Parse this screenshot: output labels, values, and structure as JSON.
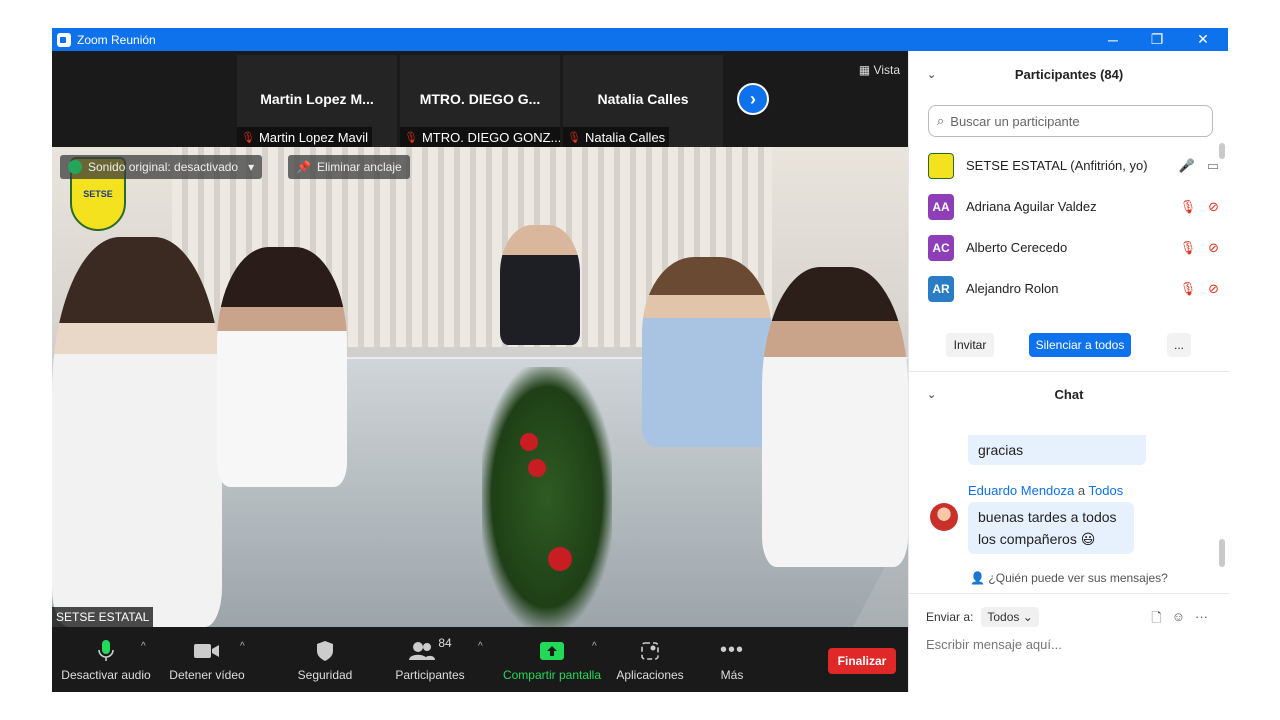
{
  "window": {
    "title": "Zoom Reunión",
    "controls": [
      "─",
      "❐",
      "✕"
    ]
  },
  "strip": {
    "tiles": [
      {
        "name": "Martin Lopez M...",
        "label": "Martin Lopez Mavil"
      },
      {
        "name": "MTRO. DIEGO G...",
        "label": "MTRO. DIEGO GONZ..."
      },
      {
        "name": "Natalia Calles",
        "label": "Natalia Calles"
      }
    ],
    "view_label": "Vista"
  },
  "video": {
    "sound_label": "Sonido original: desactivado",
    "unpin_label": "Eliminar anclaje",
    "speaker": "SETSE ESTATAL",
    "logo_text": "SETSE"
  },
  "toolbar": {
    "audio": "Desactivar audio",
    "video": "Detener vídeo",
    "security": "Seguridad",
    "participants": "Participantes",
    "participants_count": "84",
    "share": "Compartir pantalla",
    "apps": "Aplicaciones",
    "more": "Más",
    "end": "Finalizar"
  },
  "panel": {
    "participants_header": "Participantes (84)",
    "search_placeholder": "Buscar un participante",
    "participants": [
      {
        "initials": "",
        "name": "SETSE ESTATAL (Anfitrión, yo)",
        "color": "#f4e21f",
        "muted": false
      },
      {
        "initials": "AA",
        "name": "Adriana Aguilar Valdez",
        "color": "#8e3fb8",
        "muted": true
      },
      {
        "initials": "AC",
        "name": "Alberto Cerecedo",
        "color": "#8e3fb8",
        "muted": true
      },
      {
        "initials": "AR",
        "name": "Alejandro Rolon",
        "color": "#2a7dc4",
        "muted": true
      }
    ],
    "invite": "Invitar",
    "mute_all": "Silenciar a todos",
    "more": "...",
    "chat_header": "Chat",
    "chat": {
      "prev_message": "gracias",
      "sender": "Eduardo Mendoza",
      "to_word": "a",
      "recipient": "Todos",
      "message_line1": "buenas tardes a todos",
      "message_line2": "los compañeros",
      "emoji": "😃"
    },
    "who_can_see": "¿Quién puede ver sus mensajes?",
    "send_to_label": "Enviar a:",
    "send_to_value": "Todos",
    "input_placeholder": "Escribir mensaje aquí..."
  },
  "colors": {
    "zoom_blue": "#0e72ed",
    "end_red": "#e02828",
    "share_green": "#23d959",
    "muted_red": "#e0301e"
  }
}
